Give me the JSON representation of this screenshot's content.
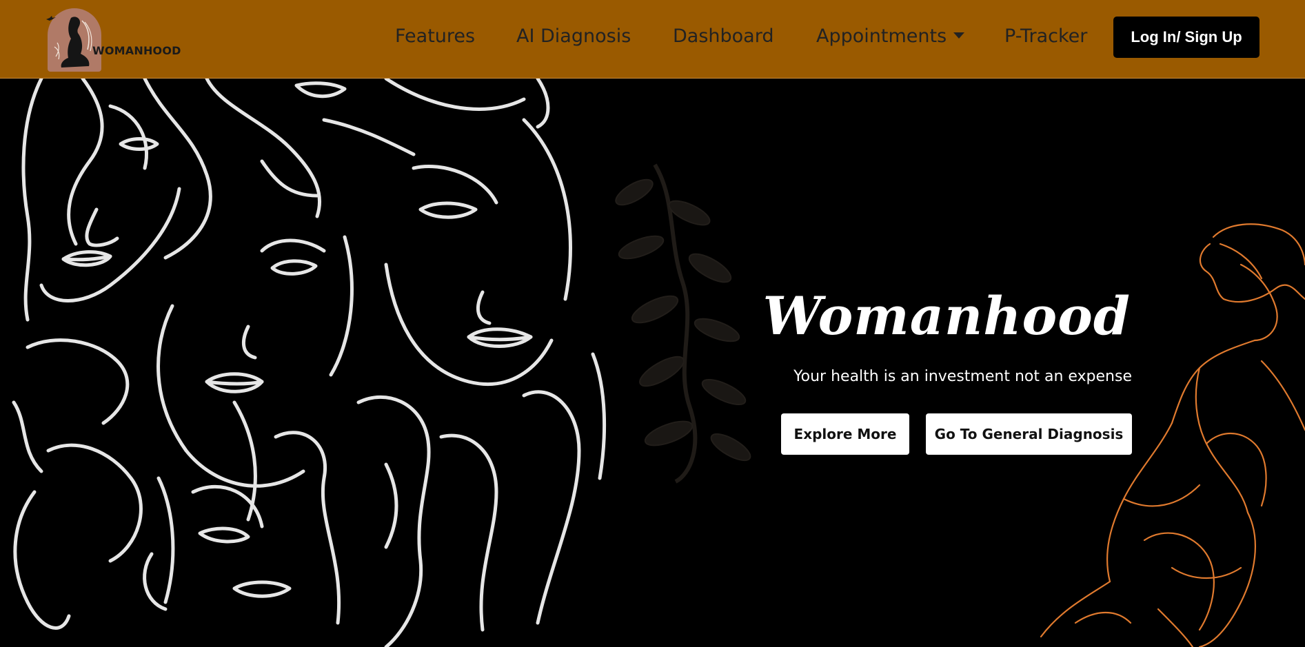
{
  "brand": {
    "logo_text": "WOMANHOOD",
    "logo_icon": "woman-silhouette-logo-icon",
    "colors": {
      "navbar": "#9a5a00",
      "logo_arch": "#b07a67",
      "hero_bg": "#000000",
      "accent_orange": "#e07a2e"
    }
  },
  "nav": {
    "items": [
      {
        "label": "Features"
      },
      {
        "label": "AI Diagnosis"
      },
      {
        "label": "Dashboard"
      },
      {
        "label": "Appointments",
        "icon": "caret-down-icon"
      },
      {
        "label": "P-Tracker"
      }
    ],
    "login_label": "Log In/ Sign Up"
  },
  "hero": {
    "title": "Womanhood",
    "tagline": "Your health is an investment not an expense",
    "explore_label": "Explore More",
    "diagnosis_label": "Go To General Diagnosis"
  }
}
